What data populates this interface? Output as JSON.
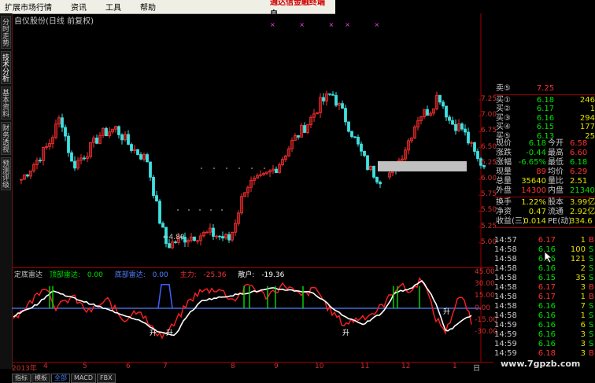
{
  "menu": {
    "items": [
      "扩展市场行情",
      "资讯",
      "工具",
      "帮助"
    ],
    "brand": "通达信金融终端",
    "brand_tail": "自"
  },
  "left_tabs": [
    "分时走势",
    "技术分析",
    "基本资料",
    "财务透视",
    "预测评级"
  ],
  "chart_title": "自仪股份(日线 前复权)",
  "price_axis": {
    "labels": [
      "7.25",
      "7.00",
      "6.75",
      "6.50",
      "6.25",
      "6.00",
      "5.75",
      "5.50",
      "5.25",
      "5.00"
    ]
  },
  "low_marker": "4.80",
  "indicator": {
    "name": "定底雷达",
    "attack_label": "顶部雷达:",
    "attack_val": "0.00",
    "bottom_label": "底部雷达:",
    "bottom_val": "0.00",
    "main_label": "主力:",
    "main_val": "-25.36",
    "retail_label": "散户:",
    "retail_val": "-19.36",
    "axis_labels": [
      "45.00",
      "30.00",
      "15.00",
      "0.00",
      "-15.00",
      "-30.00"
    ],
    "marks": [
      "升",
      "升",
      "升",
      "升"
    ]
  },
  "date_axis": {
    "year": "2013年",
    "months": [
      "4",
      "5",
      "6",
      "7",
      "8",
      "9",
      "10",
      "11",
      "12",
      "1"
    ],
    "end": "日"
  },
  "bottom_tabs": [
    "指标",
    "模板",
    "全部",
    "MACD",
    "FBX"
  ],
  "order_book": [
    {
      "label": "卖⑤",
      "price": "7.25",
      "vol": ""
    },
    {
      "label": "买①",
      "price": "6.18",
      "vol": "246"
    },
    {
      "label": "买②",
      "price": "6.17",
      "vol": "1"
    },
    {
      "label": "买③",
      "price": "6.16",
      "vol": "294"
    },
    {
      "label": "买④",
      "price": "6.15",
      "vol": "177"
    },
    {
      "label": "买⑤",
      "price": "6.13",
      "vol": "25"
    }
  ],
  "quote": [
    {
      "l1": "现价",
      "v1": "6.18",
      "l2": "今开",
      "v2": "6.58"
    },
    {
      "l1": "涨跌",
      "v1": "-0.44",
      "l2": "最高",
      "v2": "6.60"
    },
    {
      "l1": "涨幅",
      "v1": "-6.65%",
      "l2": "最低",
      "v2": "6.18"
    },
    {
      "l1": "现量",
      "v1": "89",
      "l2": "均价",
      "v2": "6.29"
    },
    {
      "l1": "总量",
      "v1": "35640",
      "l2": "量比",
      "v2": "2.51"
    },
    {
      "l1": "外盘",
      "v1": "14300",
      "l2": "内盘",
      "v2": "21340"
    },
    {
      "l1": "换手",
      "v1": "1.22%",
      "l2": "股本",
      "v2": "3.99亿"
    },
    {
      "l1": "净资",
      "v1": "0.47",
      "l2": "流通",
      "v2": "2.92亿"
    },
    {
      "l1": "收益(三)",
      "v1": "0.014",
      "l2": "PE(动)",
      "v2": "334.6"
    }
  ],
  "trades": [
    {
      "t": "14:57",
      "p": "6.17",
      "v": "1",
      "f": "B"
    },
    {
      "t": "14:58",
      "p": "6.16",
      "v": "100",
      "f": "S"
    },
    {
      "t": "14:58",
      "p": "6.16",
      "v": "121",
      "f": "S"
    },
    {
      "t": "14:58",
      "p": "6.16",
      "v": "2",
      "f": "S"
    },
    {
      "t": "14:58",
      "p": "6.15",
      "v": "35",
      "f": "S"
    },
    {
      "t": "14:58",
      "p": "6.17",
      "v": "3",
      "f": "B"
    },
    {
      "t": "14:58",
      "p": "6.17",
      "v": "1",
      "f": "B"
    },
    {
      "t": "14:58",
      "p": "6.16",
      "v": "7",
      "f": "S"
    },
    {
      "t": "14:58",
      "p": "6.16",
      "v": "1",
      "f": "S"
    },
    {
      "t": "14:59",
      "p": "6.16",
      "v": "6",
      "f": "S"
    },
    {
      "t": "14:59",
      "p": "6.16",
      "v": "3",
      "f": "S"
    },
    {
      "t": "14:59",
      "p": "6.16",
      "v": "3",
      "f": "S"
    },
    {
      "t": "14:59",
      "p": "6.18",
      "v": "3",
      "f": "B"
    }
  ],
  "watermark": "www.7gpzb.com",
  "colors": {
    "up": "#ff3030",
    "down": "#40e0e0",
    "axis": "#a00000",
    "white": "#ffffff",
    "yellow": "#e0e000",
    "green": "#00e000",
    "blue": "#5080ff"
  }
}
